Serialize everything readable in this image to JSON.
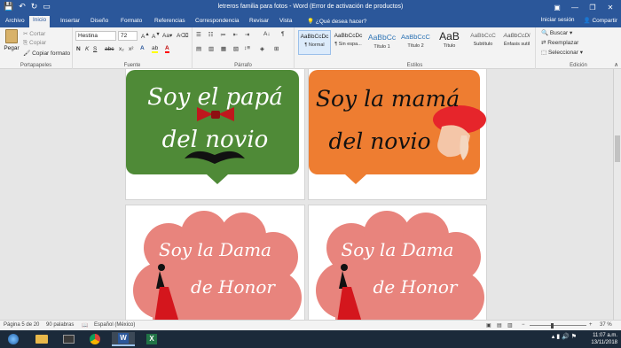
{
  "window": {
    "title": "letreros familia para fotos - Word (Error de activación de productos)",
    "minimize": "—",
    "maximize": "❐",
    "close": "✕"
  },
  "tabs": {
    "items": [
      "Archivo",
      "Inicio",
      "Insertar",
      "Diseño",
      "Formato",
      "Referencias",
      "Correspondencia",
      "Revisar",
      "Vista"
    ],
    "tell_me": "¿Qué desea hacer?",
    "signin": "Iniciar sesión",
    "share": "Compartir"
  },
  "clipboard": {
    "paste": "Pegar",
    "cut": "Cortar",
    "copy": "Copiar",
    "format_painter": "Copiar formato",
    "label": "Portapapeles"
  },
  "font": {
    "name": "Hestina",
    "size": "72",
    "bold": "N",
    "italic": "K",
    "underline": "S",
    "strike": "abc",
    "sub": "x₂",
    "sup": "x²",
    "label": "Fuente"
  },
  "paragraph": {
    "label": "Párrafo"
  },
  "styles": {
    "items": [
      {
        "sample": "AaBbCcDc",
        "name": "¶ Normal"
      },
      {
        "sample": "AaBbCcDc",
        "name": "¶ Sin espa..."
      },
      {
        "sample": "AaBbCc",
        "name": "Título 1"
      },
      {
        "sample": "AaBbCcC",
        "name": "Título 2"
      },
      {
        "sample": "AaB",
        "name": "Título"
      },
      {
        "sample": "AaBbCcC",
        "name": "Subtítulo"
      },
      {
        "sample": "AaBbCcDi",
        "name": "Énfasis sutil"
      }
    ],
    "label": "Estilos"
  },
  "editing": {
    "find": "Buscar",
    "replace": "Reemplazar",
    "select": "Seleccionar",
    "label": "Edición"
  },
  "signs": [
    {
      "line1": "Soy el papá",
      "line2": "del novio"
    },
    {
      "line1": "Soy la mamá",
      "line2": "del novio"
    },
    {
      "line1": "Soy la Dama",
      "line2": "de Honor"
    },
    {
      "line1": "Soy la Dama",
      "line2": "de Honor"
    }
  ],
  "status": {
    "page": "Página 5 de 20",
    "words": "90 palabras",
    "language": "Español (México)",
    "zoom": "37 %"
  },
  "tray": {
    "time": "11:07 a.m.",
    "date": "13/11/2018"
  },
  "colors": {
    "word_blue": "#2b579a",
    "green_sign": "#4f8a37",
    "orange_sign": "#ee7d31",
    "pink_cloud": "#e8847d"
  }
}
